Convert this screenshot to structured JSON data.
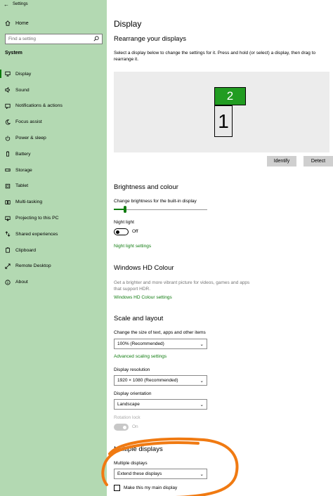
{
  "window": {
    "title": "Settings"
  },
  "sidebar": {
    "home_label": "Home",
    "search_placeholder": "Find a setting",
    "section": "System",
    "items": [
      {
        "label": "Display",
        "icon": "monitor-icon"
      },
      {
        "label": "Sound",
        "icon": "speaker-icon"
      },
      {
        "label": "Notifications & actions",
        "icon": "notifications-icon"
      },
      {
        "label": "Focus assist",
        "icon": "moon-icon"
      },
      {
        "label": "Power & sleep",
        "icon": "power-icon"
      },
      {
        "label": "Battery",
        "icon": "battery-icon"
      },
      {
        "label": "Storage",
        "icon": "storage-icon"
      },
      {
        "label": "Tablet",
        "icon": "tablet-icon"
      },
      {
        "label": "Multi-tasking",
        "icon": "multitasking-icon"
      },
      {
        "label": "Projecting to this PC",
        "icon": "projecting-icon"
      },
      {
        "label": "Shared experiences",
        "icon": "shared-experiences-icon"
      },
      {
        "label": "Clipboard",
        "icon": "clipboard-icon"
      },
      {
        "label": "Remote Desktop",
        "icon": "remote-desktop-icon"
      },
      {
        "label": "About",
        "icon": "info-icon"
      }
    ]
  },
  "main": {
    "title": "Display",
    "rearrange": {
      "heading": "Rearrange your displays",
      "description_line1": "Select a display below to change the settings for it. Press and hold (or select) a display, then drag to",
      "description_line2": "rearrange it.",
      "display_1": "1",
      "display_2": "2",
      "identify_label": "Identify",
      "detect_label": "Detect"
    },
    "brightness": {
      "heading": "Brightness and colour",
      "slider_label": "Change brightness for the built-in display",
      "level_percent": 12,
      "night_light_label": "Night light",
      "night_light_state": "Off",
      "night_light_link": "Night light settings"
    },
    "hdr": {
      "heading": "Windows HD Colour",
      "description_line1": "Get a brighter and more vibrant picture for videos, games and apps",
      "description_line2": "that support HDR.",
      "link": "Windows HD Colour settings"
    },
    "scale": {
      "heading": "Scale and layout",
      "size_label": "Change the size of text, apps and other items",
      "size_value": "100% (Recommended)",
      "advanced_link": "Advanced scaling settings",
      "resolution_label": "Display resolution",
      "resolution_value": "1920 × 1080 (Recommended)",
      "orientation_label": "Display orientation",
      "orientation_value": "Landscape",
      "rotation_lock_label": "Rotation lock",
      "rotation_lock_state": "On"
    },
    "multiple": {
      "heading": "Multiple displays",
      "label": "Multiple displays",
      "value": "Extend these displays",
      "main_display_label": "Make this my main display"
    }
  },
  "colors": {
    "sidebar_bg": "#b3d9b2",
    "accent": "#107c10",
    "annotation": "#f07a12"
  }
}
